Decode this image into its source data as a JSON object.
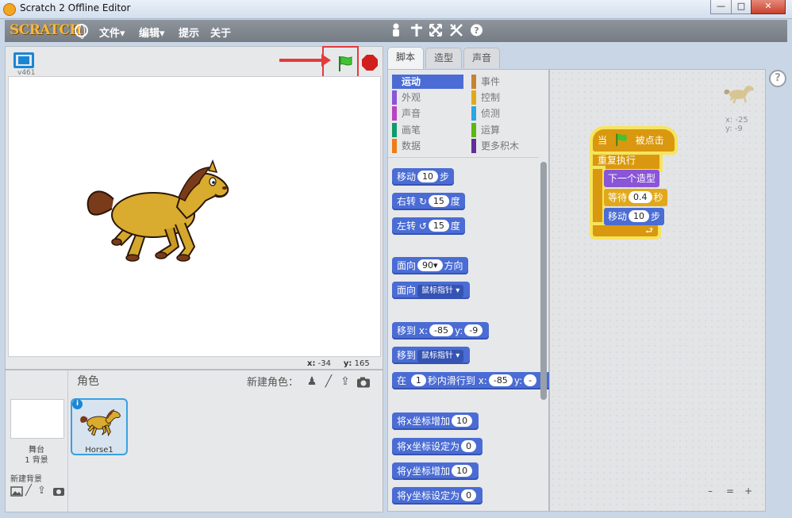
{
  "window": {
    "title": "Scratch 2 Offline Editor",
    "minimize": "—",
    "maximize": "□",
    "close": "✕"
  },
  "menubar": {
    "logo": "SCRATCH",
    "items": [
      "文件▾",
      "编辑▾",
      "提示",
      "关于"
    ],
    "tool_icons": [
      "duplicate-icon",
      "delete-icon",
      "grow-icon",
      "shrink-icon",
      "help-icon"
    ]
  },
  "stage": {
    "version": "v461",
    "mouse_x_label": "x:",
    "mouse_x": "-34",
    "mouse_y_label": "y:",
    "mouse_y": "165",
    "colors": {
      "flag": "#3ec430",
      "stop": "#d31d1d",
      "highlight": "#e43b3b"
    }
  },
  "sprites": {
    "title": "角色",
    "new_sprite_label": "新建角色：",
    "stage_label": "舞台",
    "backdrop_count": "1 背景",
    "new_backdrop_label": "新建背景",
    "sprite_name": "Horse1",
    "info": "i"
  },
  "palette": {
    "tabs": [
      "脚本",
      "造型",
      "声音"
    ],
    "categories": [
      {
        "label": "运动",
        "color": "#4a6cd4",
        "active": true
      },
      {
        "label": "事件",
        "color": "#c88330"
      },
      {
        "label": "外观",
        "color": "#8a55d7"
      },
      {
        "label": "控制",
        "color": "#e1a91a"
      },
      {
        "label": "声音",
        "color": "#bb42c3"
      },
      {
        "label": "侦测",
        "color": "#2ca5e2"
      },
      {
        "label": "画笔",
        "color": "#0e9a6c"
      },
      {
        "label": "运算",
        "color": "#5cb712"
      },
      {
        "label": "数据",
        "color": "#ee7d16"
      },
      {
        "label": "更多积木",
        "color": "#632d99"
      }
    ],
    "blocks": {
      "move": {
        "pre": "移动",
        "val": "10",
        "post": "步"
      },
      "turn_right": {
        "pre": "右转",
        "icon": "↻",
        "val": "15",
        "post": "度"
      },
      "turn_left": {
        "pre": "左转",
        "icon": "↺",
        "val": "15",
        "post": "度"
      },
      "point_dir": {
        "pre": "面向",
        "val": "90▾",
        "post": "方向"
      },
      "point_towards": {
        "pre": "面向",
        "dd": "鼠标指针 ▾"
      },
      "goto_xy": {
        "pre": "移到",
        "x_label": "x:",
        "x": "-85",
        "y_label": "y:",
        "y": "-9"
      },
      "goto": {
        "pre": "移到",
        "dd": "鼠标指针 ▾"
      },
      "glide": {
        "pre": "在",
        "val": "1",
        "mid": "秒内滑行到",
        "x_label": "x:",
        "x": "-85",
        "y_label": "y:",
        "y": "-"
      },
      "change_x": {
        "pre": "将x坐标增加",
        "val": "10"
      },
      "set_x": {
        "pre": "将x坐标设定为",
        "val": "0"
      },
      "change_y": {
        "pre": "将y坐标增加",
        "val": "10"
      },
      "set_y": {
        "pre": "将y坐标设定为",
        "val": "0"
      }
    }
  },
  "scripts": {
    "ghost_x": "x: -25",
    "ghost_y": "y: -9",
    "hat": {
      "pre": "当",
      "post": "被点击"
    },
    "forever": "重复执行",
    "next_costume": "下一个造型",
    "wait": {
      "pre": "等待",
      "val": "0.4",
      "post": "秒"
    },
    "move": {
      "pre": "移动",
      "val": "10",
      "post": "步"
    },
    "help": "?",
    "zoom_out": "–",
    "zoom_reset": "=",
    "zoom_in": "+"
  }
}
